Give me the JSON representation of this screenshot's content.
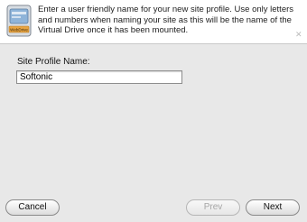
{
  "header": {
    "icon_label": "WebDrive",
    "instruction": "Enter a user friendly name for your new site profile. Use only letters and numbers when naming your site as this will be the name of the Virtual Drive once it has been mounted."
  },
  "form": {
    "site_profile_label": "Site Profile Name:",
    "site_profile_value": "Softonic"
  },
  "buttons": {
    "cancel": "Cancel",
    "prev": "Prev",
    "next": "Next"
  }
}
